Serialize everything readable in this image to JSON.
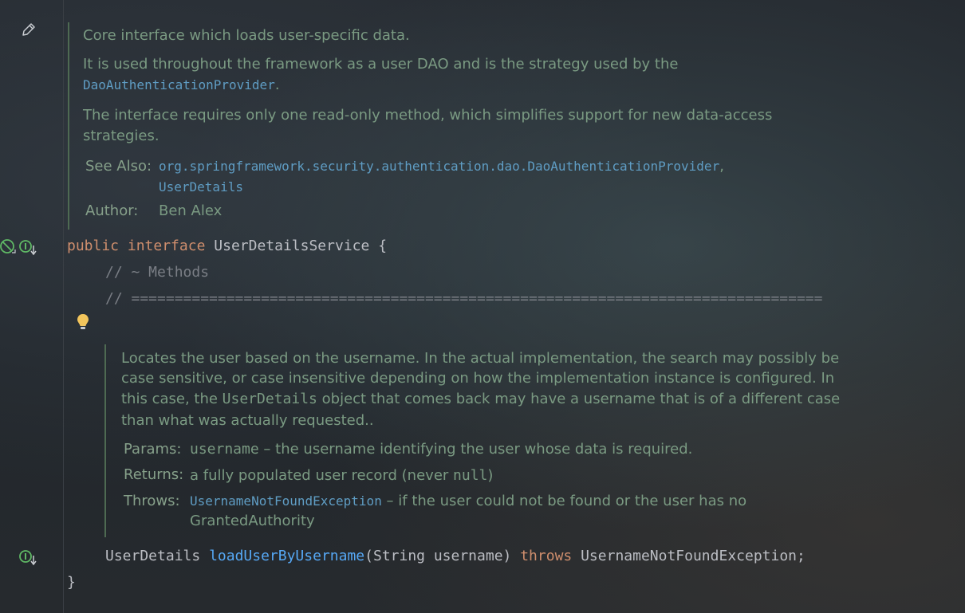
{
  "class_doc": {
    "line1": "Core interface which loads user-specific data.",
    "line2a": "It is used throughout the framework as a user DAO and is the strategy used by the",
    "line2b_link": "DaoAuthenticationProvider",
    "line2b_end": ".",
    "line3a": "The interface requires only one read-only method, which simplifies support for new data-access",
    "line3b": "strategies.",
    "see_also_label": "See Also:",
    "see_also_link1": "org.springframework.security.authentication.dao.DaoAuthenticationProvider",
    "see_also_sep": ",",
    "see_also_link2": "UserDetails",
    "author_label": "Author:",
    "author_value": "Ben Alex"
  },
  "code": {
    "kw_public": "public",
    "kw_interface": "interface",
    "class_name": "UserDetailsService",
    "open_brace": "{",
    "comment1": "// ~ Methods",
    "comment2": "// ================================================================================",
    "ret_type": "UserDetails",
    "method_name": "loadUserByUsername",
    "params": "(String username)",
    "kw_throws": "throws",
    "exception": "UsernameNotFoundException;",
    "close_brace": "}"
  },
  "method_doc": {
    "l1": "Locates the user based on the username. In the actual implementation, the search may possibly be",
    "l2": "case sensitive, or case insensitive depending on how the implementation instance is configured. In",
    "l3a": "this case, the",
    "l3_code": "UserDetails",
    "l3b": "object that comes back may have a username that is of a different case",
    "l4": "than what was actually requested..",
    "params_label": "Params:",
    "params_code": "username",
    "params_text": " – the username identifying the user whose data is required.",
    "returns_label": "Returns:",
    "returns_text": "a fully populated user record (never",
    "returns_code": "null",
    "returns_end": ")",
    "throws_label": "Throws:",
    "throws_link": "UsernameNotFoundException",
    "throws_text": " – if the user could not be found or the user has no",
    "throws_text2": "GrantedAuthority"
  },
  "icons": {
    "edit": "pencil-icon",
    "no_impl": "no-implementation-icon",
    "interface_impl": "interface-implemented-icon",
    "bulb": "lightbulb-icon"
  }
}
